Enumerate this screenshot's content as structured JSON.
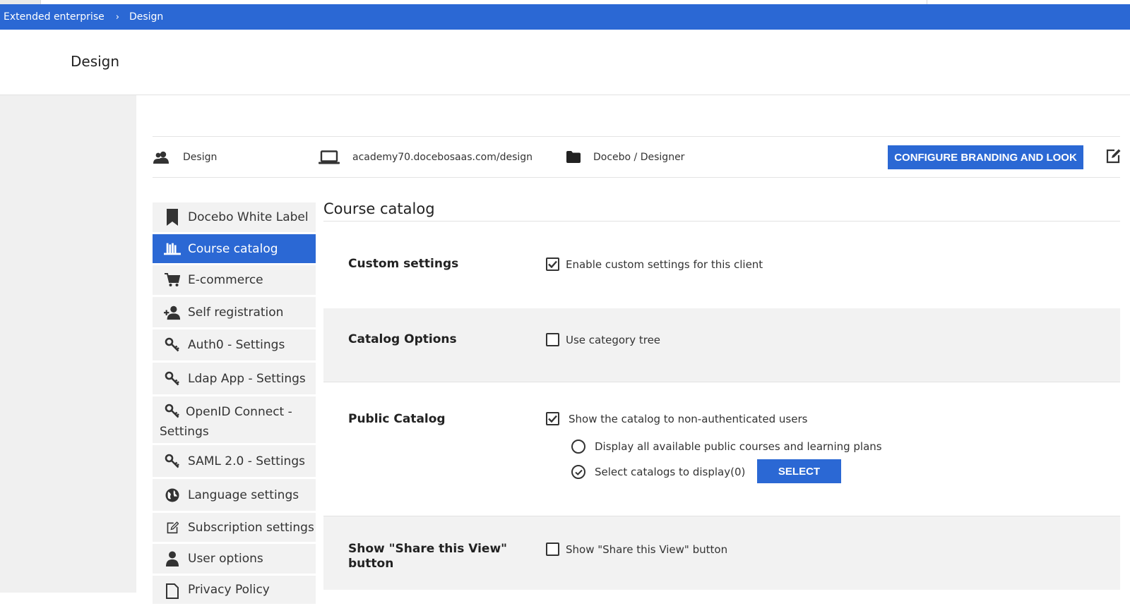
{
  "breadcrumb": {
    "items": [
      "Extended enterprise",
      "Design"
    ],
    "separator": "›"
  },
  "page": {
    "title": "Design"
  },
  "info": {
    "client_name": "Design",
    "client_icon": "users-icon",
    "domain": "academy70.docebosaas.com/design",
    "domain_icon": "laptop-icon",
    "folder": "Docebo / Designer",
    "folder_icon": "folder-icon",
    "configure_button": "CONFIGURE BRANDING AND LOOK",
    "edit_icon": "edit-icon"
  },
  "sidebar": {
    "items": [
      {
        "label": "Docebo White Label",
        "icon": "bookmark-icon",
        "active": false
      },
      {
        "label": "Course catalog",
        "icon": "library-icon",
        "active": true
      },
      {
        "label": "E-commerce",
        "icon": "cart-icon",
        "active": false
      },
      {
        "label": "Self registration",
        "icon": "add-user-icon",
        "active": false
      },
      {
        "label": "Auth0 - Settings",
        "icon": "key-icon",
        "active": false
      },
      {
        "label": "Ldap App - Settings",
        "icon": "key-icon",
        "active": false
      },
      {
        "label": "OpenID Connect - Settings",
        "icon": "key-icon",
        "active": false
      },
      {
        "label": "SAML 2.0 - Settings",
        "icon": "key-icon",
        "active": false
      },
      {
        "label": "Language settings",
        "icon": "globe-icon",
        "active": false
      },
      {
        "label": "Subscription settings",
        "icon": "edit-icon",
        "active": false
      },
      {
        "label": "User options",
        "icon": "user-icon",
        "active": false
      },
      {
        "label": "Privacy Policy",
        "icon": "document-icon",
        "active": false
      }
    ]
  },
  "content": {
    "title": "Course catalog",
    "custom_settings": {
      "label": "Custom settings",
      "checkbox_label": "Enable custom settings for this client",
      "checked": true
    },
    "catalog_options": {
      "label": "Catalog Options",
      "checkbox_label": "Use category tree",
      "checked": false
    },
    "public_catalog": {
      "label": "Public Catalog",
      "checkbox_label": "Show the catalog to non-authenticated users",
      "checked": true,
      "radio_all": "Display all available public courses and learning plans",
      "radio_select": "Select catalogs to display(0)",
      "selected_option": "select",
      "select_button": "SELECT"
    },
    "share_view": {
      "label": "Show \"Share this View\" button",
      "checkbox_label": "Show \"Share this View\" button",
      "checked": false
    }
  },
  "colors": {
    "accent": "#2b68d4",
    "panel_grey": "#f2f2f2"
  }
}
